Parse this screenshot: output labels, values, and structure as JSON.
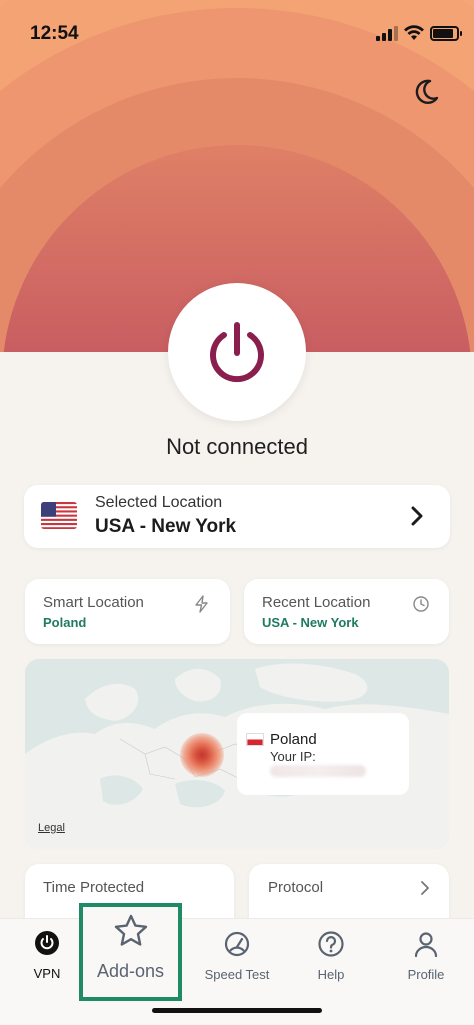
{
  "status_bar": {
    "time": "12:54"
  },
  "main": {
    "connection_status": "Not connected",
    "selected_location": {
      "label": "Selected Location",
      "value": "USA - New York"
    },
    "smart_location": {
      "label": "Smart Location",
      "value": "Poland"
    },
    "recent_location": {
      "label": "Recent Location",
      "value": "USA - New York"
    },
    "map": {
      "legal_link": "Legal",
      "country": "Poland",
      "ip_label": "Your IP:"
    },
    "time_protected": {
      "label": "Time Protected"
    },
    "protocol": {
      "label": "Protocol"
    }
  },
  "tabs": [
    {
      "label": "VPN",
      "icon": "power-icon"
    },
    {
      "label": "Add-ons",
      "icon": "star-icon"
    },
    {
      "label": "Speed Test",
      "icon": "speedometer-icon"
    },
    {
      "label": "Help",
      "icon": "question-icon"
    },
    {
      "label": "Profile",
      "icon": "person-icon"
    }
  ],
  "colors": {
    "accent": "#8a1e4f",
    "secondary": "#1f7a62",
    "highlight_box": "#1f8a66"
  }
}
